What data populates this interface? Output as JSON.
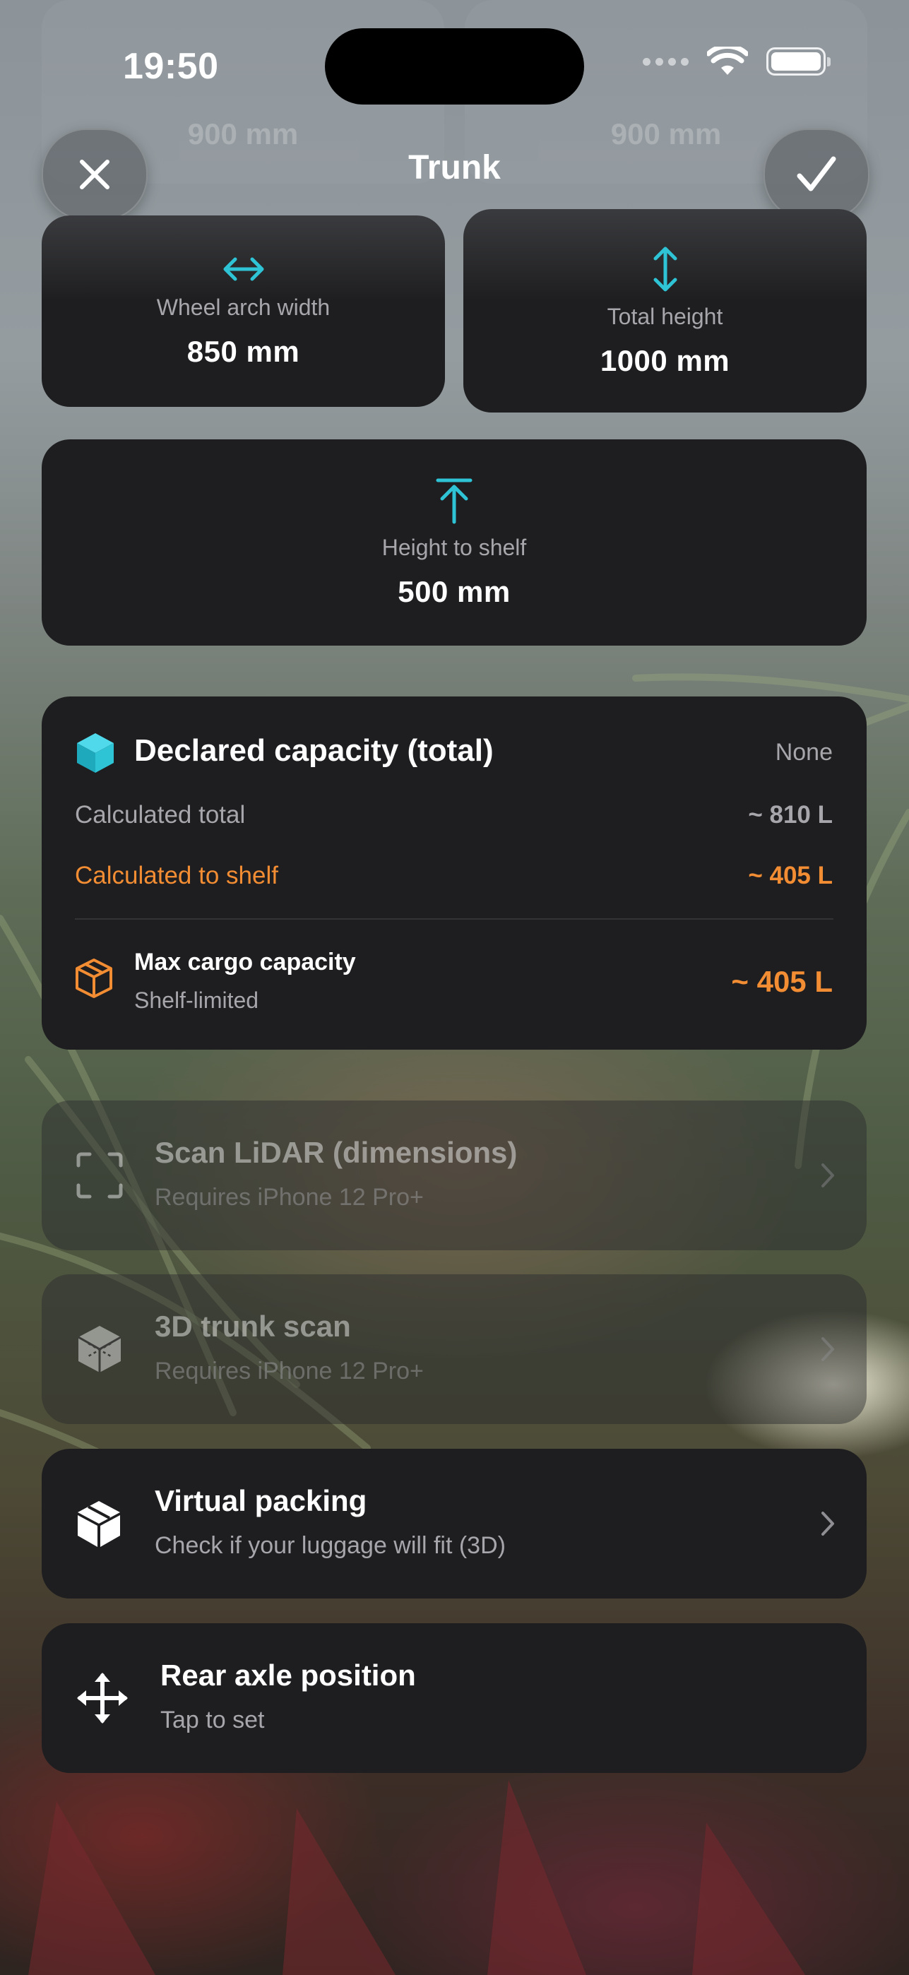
{
  "status_bar": {
    "time": "19:50"
  },
  "header": {
    "title": "Trunk",
    "close_icon": "xmark-icon",
    "confirm_icon": "checkmark-icon"
  },
  "background_ghost": {
    "left_value": "900 mm",
    "right_value": "900 mm"
  },
  "dimensions": {
    "wheel_arch": {
      "label": "Wheel arch width",
      "value": "850 mm",
      "icon": "arrow-left-right-icon"
    },
    "total_height": {
      "label": "Total height",
      "value": "1000 mm",
      "icon": "arrow-up-down-icon"
    },
    "height_to_shelf": {
      "label": "Height to shelf",
      "value": "500 mm",
      "icon": "arrow-up-to-line-icon"
    }
  },
  "capacity": {
    "title": "Declared capacity (total)",
    "declared_value": "None",
    "calculated_total_label": "Calculated total",
    "calculated_total_value": "~ 810 L",
    "calculated_shelf_label": "Calculated to shelf",
    "calculated_shelf_value": "~ 405 L",
    "max_cargo_title": "Max cargo capacity",
    "max_cargo_sub": "Shelf-limited",
    "max_cargo_value": "~ 405 L"
  },
  "actions": [
    {
      "title": "Scan LiDAR (dimensions)",
      "subtitle": "Requires iPhone 12 Pro+",
      "icon": "viewfinder-icon",
      "enabled": false
    },
    {
      "title": "3D trunk scan",
      "subtitle": "Requires iPhone 12 Pro+",
      "icon": "cube-scan-icon",
      "enabled": false
    },
    {
      "title": "Virtual packing",
      "subtitle": "Check if your luggage will fit (3D)",
      "icon": "box-icon",
      "enabled": true
    },
    {
      "title": "Rear axle position",
      "subtitle": "Tap to set",
      "icon": "move-arrows-icon",
      "enabled": true
    }
  ],
  "colors": {
    "accent_cyan": "#2ec4d6",
    "accent_orange": "#f28d33",
    "card_bg": "#1e1e20"
  }
}
